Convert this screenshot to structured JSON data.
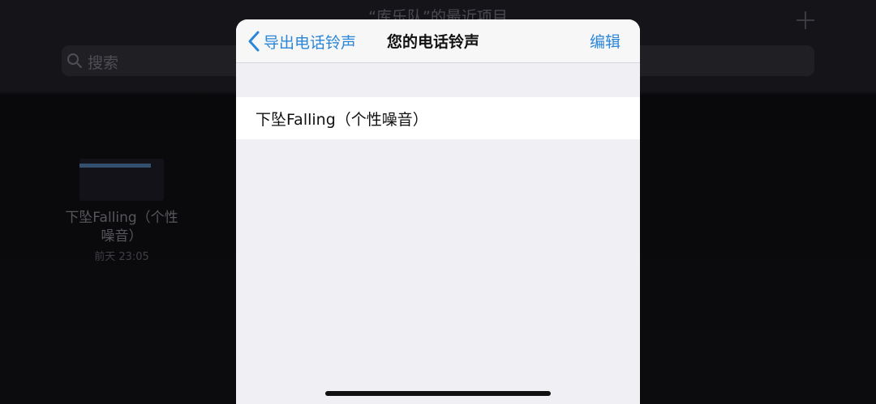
{
  "background_app": {
    "title": "“库乐队”的最近项目",
    "search_placeholder": "搜索",
    "project": {
      "name_line1": "下坠Falling（个性",
      "name_line2": "噪音）",
      "date": "前天 23:05"
    },
    "icons": {
      "add": "plus-icon",
      "search": "search-icon"
    }
  },
  "sheet": {
    "back_label": "导出电话铃声",
    "title": "您的电话铃声",
    "edit_label": "编辑",
    "rows": [
      {
        "label": "下坠Falling（个性噪音）"
      }
    ],
    "icons": {
      "back": "chevron-left-icon"
    }
  },
  "colors": {
    "accent": "#2a86d9",
    "sheet_background": "#efeff4",
    "row_background": "#ffffff",
    "text": "#111111"
  }
}
